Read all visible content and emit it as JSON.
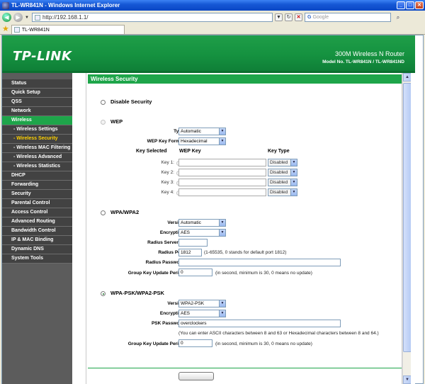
{
  "window": {
    "title": "TL-WR841N - Windows Internet Explorer"
  },
  "browser": {
    "address": "http://192.168.1.1/",
    "search_placeholder": "Google",
    "tab_label": "TL-WR841N"
  },
  "header": {
    "logo": "TP-LINK",
    "product": "300M Wireless N Router",
    "model": "Model No. TL-WR841N / TL-WR841ND",
    "brand_color": "#1ea54a"
  },
  "sidebar": {
    "items": [
      {
        "label": "Status",
        "type": "main"
      },
      {
        "label": "Quick Setup",
        "type": "main"
      },
      {
        "label": "QSS",
        "type": "main"
      },
      {
        "label": "Network",
        "type": "main"
      },
      {
        "label": "Wireless",
        "type": "main",
        "active": true
      },
      {
        "label": "- Wireless Settings",
        "type": "sub"
      },
      {
        "label": "- Wireless Security",
        "type": "sub",
        "current": true
      },
      {
        "label": "- Wireless MAC Filtering",
        "type": "sub"
      },
      {
        "label": "- Wireless Advanced",
        "type": "sub"
      },
      {
        "label": "- Wireless Statistics",
        "type": "sub"
      },
      {
        "label": "DHCP",
        "type": "main"
      },
      {
        "label": "Forwarding",
        "type": "main"
      },
      {
        "label": "Security",
        "type": "main"
      },
      {
        "label": "Parental Control",
        "type": "main"
      },
      {
        "label": "Access Control",
        "type": "main"
      },
      {
        "label": "Advanced Routing",
        "type": "main"
      },
      {
        "label": "Bandwidth Control",
        "type": "main"
      },
      {
        "label": "IP & MAC Binding",
        "type": "main"
      },
      {
        "label": "Dynamic DNS",
        "type": "main"
      },
      {
        "label": "System Tools",
        "type": "main"
      }
    ]
  },
  "main": {
    "section_title": "Wireless Security",
    "disable": {
      "label": "Disable Security"
    },
    "wep": {
      "label": "WEP",
      "type_label": "Type:",
      "type_value": "Automatic",
      "format_label": "WEP Key Format:",
      "format_value": "Hexadecimal",
      "key_selected_head": "Key Selected",
      "wep_key_head": "WEP Key",
      "key_type_head": "Key Type",
      "keys": [
        {
          "label": "Key 1:",
          "value": "",
          "type": "Disabled"
        },
        {
          "label": "Key 2:",
          "value": "",
          "type": "Disabled"
        },
        {
          "label": "Key 3:",
          "value": "",
          "type": "Disabled"
        },
        {
          "label": "Key 4:",
          "value": "",
          "type": "Disabled"
        }
      ]
    },
    "wpa": {
      "label": "WPA/WPA2",
      "version_label": "Version:",
      "version_value": "Automatic",
      "encryption_label": "Encryption:",
      "encryption_value": "AES",
      "radius_ip_label": "Radius Server IP:",
      "radius_ip_value": "",
      "radius_port_label": "Radius Port:",
      "radius_port_value": "1812",
      "radius_port_note": "(1-65535, 0 stands for default port 1812)",
      "radius_pw_label": "Radius Password:",
      "radius_pw_value": "",
      "group_label": "Group Key Update Period:",
      "group_value": "0",
      "group_note": "(in second, minimum is 30, 0 means no update)"
    },
    "psk": {
      "label": "WPA-PSK/WPA2-PSK",
      "version_label": "Version:",
      "version_value": "WPA2-PSK",
      "encryption_label": "Encryption:",
      "encryption_value": "AES",
      "psk_label": "PSK Password:",
      "psk_value": "overclockers",
      "psk_note": "(You can enter ASCII characters between 8 and 63 or Hexadecimal characters between 8 and 64.)",
      "group_label": "Group Key Update Period:",
      "group_value": "0",
      "group_note": "(in second, minimum is 30, 0 means no update)"
    }
  }
}
